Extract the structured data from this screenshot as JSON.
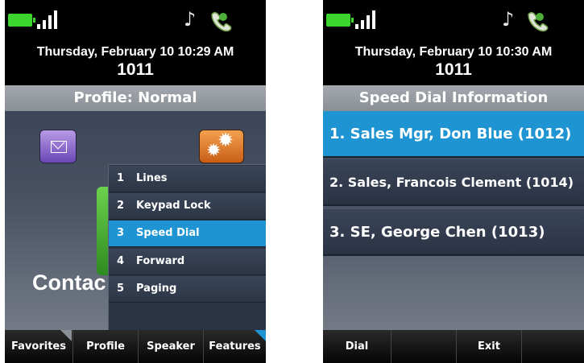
{
  "colors": {
    "accent": "#1e94d2",
    "battery": "#3dd62e"
  },
  "icons": {
    "battery": "battery-icon",
    "signal": "signal-icon",
    "ringer": "music-note-icon",
    "phone": "handset-icon"
  },
  "screen1": {
    "date": "Thursday, February 10 10:29 AM",
    "extension": "1011",
    "header": "Profile: Normal",
    "app_icons": [
      "mail-icon",
      "settings-icon",
      "contacts-icon"
    ],
    "contacts_label": "Contac",
    "menu": [
      {
        "num": "1",
        "label": "Lines"
      },
      {
        "num": "2",
        "label": "Keypad Lock"
      },
      {
        "num": "3",
        "label": "Speed Dial",
        "selected": true
      },
      {
        "num": "4",
        "label": "Forward"
      },
      {
        "num": "5",
        "label": "Paging"
      }
    ],
    "softkeys": [
      "Favorites",
      "Profile",
      "Speaker",
      "Features"
    ]
  },
  "screen2": {
    "date": "Thursday, February 10 10:30 AM",
    "extension": "1011",
    "header": "Speed Dial Information",
    "items": [
      {
        "label": "1. Sales Mgr, Don Blue (1012)",
        "selected": true
      },
      {
        "label": "2. Sales, Francois Clement (1014)"
      },
      {
        "label": "3. SE, George Chen (1013)"
      }
    ],
    "softkeys": [
      "Dial",
      "",
      "Exit",
      ""
    ]
  }
}
